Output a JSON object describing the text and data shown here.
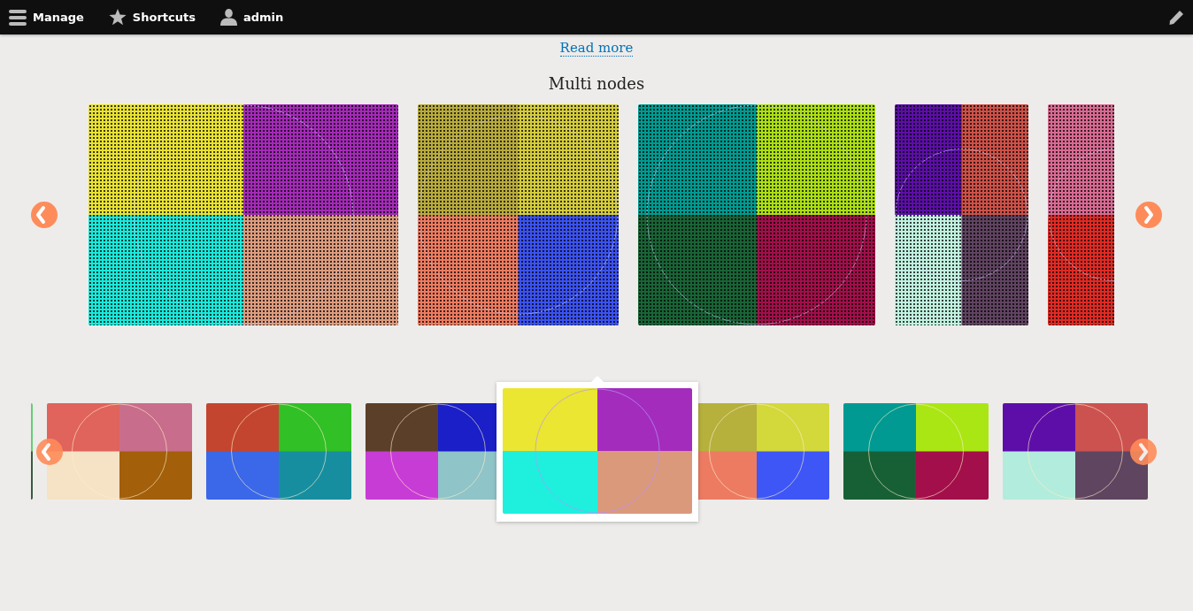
{
  "toolbar": {
    "items": [
      {
        "kind": "menu",
        "label": "Manage"
      },
      {
        "kind": "star",
        "label": "Shortcuts"
      },
      {
        "kind": "user",
        "label": "admin"
      }
    ]
  },
  "read_more": "Read more",
  "section_title": "Multi nodes",
  "slides": [
    {
      "quadrants": [
        {
          "color": "#e9e233"
        },
        {
          "color": "#a42ab7"
        },
        {
          "color": "#1ae9da"
        },
        {
          "color": "#dd9c7e"
        }
      ]
    },
    {
      "quadrants": [
        {
          "color": "#b8ab3d"
        },
        {
          "color": "#d4cc3c"
        },
        {
          "color": "#ec7b60"
        },
        {
          "color": "#3b52f0"
        }
      ]
    },
    {
      "quadrants": [
        {
          "color": "#009a90"
        },
        {
          "color": "#acdf14"
        },
        {
          "color": "#196336"
        },
        {
          "color": "#a10f4a"
        }
      ]
    },
    {
      "quadrants": [
        {
          "color": "#5c0ea6"
        },
        {
          "color": "#cc5148"
        },
        {
          "color": "#c1f2e0"
        },
        {
          "color": "#5f4360"
        }
      ]
    },
    {
      "quadrants": [
        {
          "color": "#d86a92"
        },
        {
          "color": "#df2a24"
        }
      ]
    }
  ],
  "thumbnails": [
    {
      "selected": false,
      "quadrants": [
        {
          "color": "#66cc77"
        },
        {
          "color": "#3a5a40"
        }
      ]
    },
    {
      "selected": false,
      "quadrants": [
        {
          "color": "#e0635c"
        },
        {
          "color": "#c96d8c"
        },
        {
          "color": "#f6e2c5"
        },
        {
          "color": "#a35f0a"
        }
      ]
    },
    {
      "selected": false,
      "quadrants": [
        {
          "color": "#c4452f"
        },
        {
          "color": "#31c025"
        },
        {
          "color": "#3a68e8"
        },
        {
          "color": "#178ea0"
        }
      ]
    },
    {
      "selected": false,
      "quadrants": [
        {
          "color": "#5b3f28"
        },
        {
          "color": "#1a1fc7"
        },
        {
          "color": "#c83cd6"
        },
        {
          "color": "#8fc4c9"
        }
      ]
    },
    {
      "selected": true,
      "quadrants": [
        {
          "color": "#ebe631"
        },
        {
          "color": "#a42cbc"
        },
        {
          "color": "#1ef0dd"
        },
        {
          "color": "#db997c"
        }
      ]
    },
    {
      "selected": false,
      "quadrants": [
        {
          "color": "#b6b03d"
        },
        {
          "color": "#d3d83b"
        },
        {
          "color": "#ec7b62"
        },
        {
          "color": "#3e56f6"
        }
      ]
    },
    {
      "selected": false,
      "quadrants": [
        {
          "color": "#009a92"
        },
        {
          "color": "#aae614"
        },
        {
          "color": "#176036"
        },
        {
          "color": "#a30f4a"
        }
      ]
    },
    {
      "selected": false,
      "quadrants": [
        {
          "color": "#5e0ea8"
        },
        {
          "color": "#cc5250"
        },
        {
          "color": "#b2ecdc"
        },
        {
          "color": "#604561"
        }
      ]
    }
  ]
}
